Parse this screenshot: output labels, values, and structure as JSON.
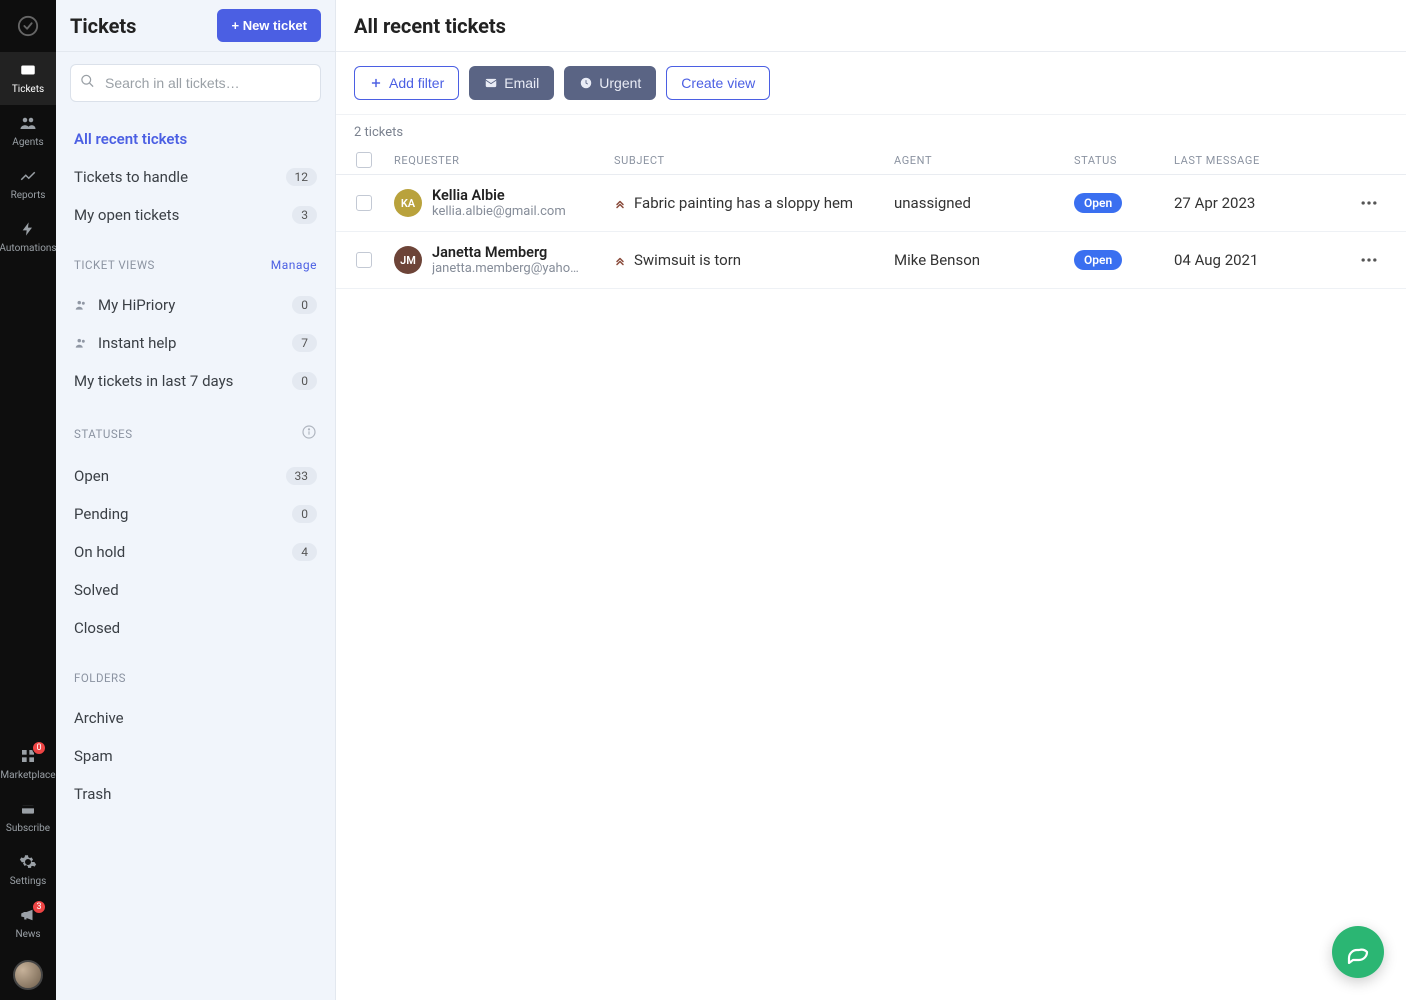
{
  "rail": {
    "items_top": [
      {
        "id": "tickets",
        "label": "Tickets",
        "active": true
      },
      {
        "id": "agents",
        "label": "Agents"
      },
      {
        "id": "reports",
        "label": "Reports"
      },
      {
        "id": "automations",
        "label": "Automations"
      }
    ],
    "items_bottom": [
      {
        "id": "marketplace",
        "label": "Marketplace",
        "badge": "0"
      },
      {
        "id": "subscribe",
        "label": "Subscribe"
      },
      {
        "id": "settings",
        "label": "Settings"
      },
      {
        "id": "news",
        "label": "News",
        "badge": "3"
      }
    ]
  },
  "sidebar": {
    "title": "Tickets",
    "new_ticket_label": "+ New ticket",
    "search_placeholder": "Search in all tickets…",
    "primary": [
      {
        "label": "All recent tickets",
        "count": null,
        "active": true
      },
      {
        "label": "Tickets to handle",
        "count": "12"
      },
      {
        "label": "My open tickets",
        "count": "3"
      }
    ],
    "views_header": "TICKET VIEWS",
    "manage_label": "Manage",
    "views": [
      {
        "label": "My HiPriory",
        "count": "0",
        "icon": true
      },
      {
        "label": "Instant help",
        "count": "7",
        "icon": true
      },
      {
        "label": "My tickets in last 7 days",
        "count": "0",
        "icon": false
      }
    ],
    "statuses_header": "STATUSES",
    "statuses": [
      {
        "label": "Open",
        "count": "33"
      },
      {
        "label": "Pending",
        "count": "0"
      },
      {
        "label": "On hold",
        "count": "4"
      },
      {
        "label": "Solved",
        "count": null
      },
      {
        "label": "Closed",
        "count": null
      }
    ],
    "folders_header": "FOLDERS",
    "folders": [
      {
        "label": "Archive"
      },
      {
        "label": "Spam"
      },
      {
        "label": "Trash"
      }
    ]
  },
  "main": {
    "title": "All recent tickets",
    "filters": {
      "add_filter": "Add filter",
      "email": "Email",
      "urgent": "Urgent",
      "create_view": "Create view"
    },
    "result_count": "2 tickets",
    "columns": {
      "requester": "REQUESTER",
      "subject": "SUBJECT",
      "agent": "AGENT",
      "status": "STATUS",
      "last_message": "LAST MESSAGE"
    },
    "rows": [
      {
        "initials": "KA",
        "avatar_color": "#b9a23c",
        "name": "Kellia Albie",
        "email": "kellia.albie@gmail.com",
        "subject": "Fabric painting has a sloppy hem",
        "agent": "unassigned",
        "status": "Open",
        "date": "27 Apr 2023"
      },
      {
        "initials": "JM",
        "avatar_color": "#6d4438",
        "name": "Janetta Memberg",
        "email": "janetta.memberg@yaho…",
        "subject": "Swimsuit is torn",
        "agent": "Mike Benson",
        "status": "Open",
        "date": "04 Aug 2021"
      }
    ]
  }
}
